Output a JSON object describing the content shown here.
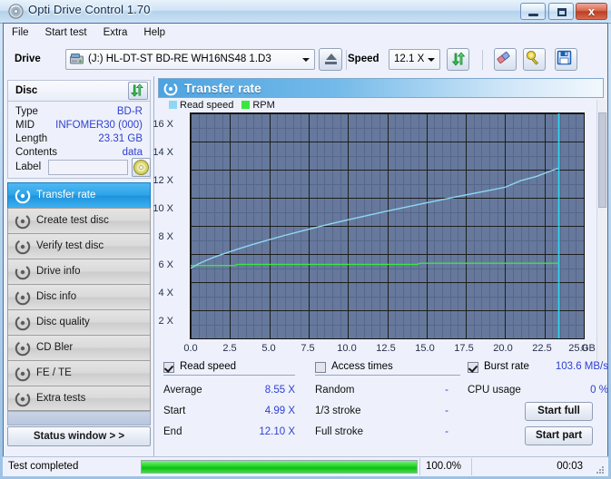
{
  "window": {
    "title": "Opti Drive Control 1.70",
    "icon": "disc-icon",
    "minimize_label": "",
    "maximize_label": "",
    "close_label": "x"
  },
  "menu": {
    "items": [
      "File",
      "Start test",
      "Extra",
      "Help"
    ]
  },
  "toolbar": {
    "drive_label": "Drive",
    "drive_value": "(J:)  HL-DT-ST BD-RE  WH16NS48 1.D3",
    "drive_icon": "drive-icon",
    "eject_label": "eject-icon",
    "speed_label": "Speed",
    "speed_value": "12.1 X",
    "refresh_icon": "refresh-arrows-icon",
    "eraser_icon": "eraser-icon",
    "bulb_icon": "bulb-icon",
    "save_icon": "floppy-save-icon"
  },
  "disc": {
    "header": "Disc",
    "refresh_icon": "refresh-arrows-icon",
    "fields": [
      {
        "key": "Type",
        "value": "BD-R"
      },
      {
        "key": "MID",
        "value": "INFOMER30 (000)"
      },
      {
        "key": "Length",
        "value": "23.31 GB"
      },
      {
        "key": "Contents",
        "value": "data"
      }
    ],
    "label_key": "Label",
    "label_value": "",
    "label_placeholder": "",
    "label_button_icon": "cd-disc-icon"
  },
  "nav": {
    "items": [
      {
        "label": "Transfer rate",
        "icon": "disc-spin-icon",
        "active": true
      },
      {
        "label": "Create test disc",
        "icon": "disc-write-icon",
        "active": false
      },
      {
        "label": "Verify test disc",
        "icon": "disc-check-icon",
        "active": false
      },
      {
        "label": "Drive info",
        "icon": "drive-info-icon",
        "active": false
      },
      {
        "label": "Disc info",
        "icon": "disc-info-icon",
        "active": false
      },
      {
        "label": "Disc quality",
        "icon": "disc-quality-icon",
        "active": false
      },
      {
        "label": "CD Bler",
        "icon": "disc-bler-icon",
        "active": false
      },
      {
        "label": "FE / TE",
        "icon": "disc-fete-icon",
        "active": false
      },
      {
        "label": "Extra tests",
        "icon": "disc-extra-icon",
        "active": false
      }
    ],
    "status_window": "Status window > >"
  },
  "panel": {
    "title": "Transfer rate",
    "icon": "disc-spin-icon"
  },
  "stats": {
    "read_speed": {
      "checkbox_label": "Read speed",
      "checked": true,
      "rows": [
        {
          "key": "Average",
          "value": "8.55 X"
        },
        {
          "key": "Start",
          "value": "4.99 X"
        },
        {
          "key": "End",
          "value": "12.10 X"
        }
      ]
    },
    "access_times": {
      "checkbox_label": "Access times",
      "checked": false,
      "rows": [
        {
          "key": "Random",
          "value": "-"
        },
        {
          "key": "1/3 stroke",
          "value": "-"
        },
        {
          "key": "Full stroke",
          "value": "-"
        }
      ]
    },
    "burst_rate": {
      "checkbox_label": "Burst rate",
      "checked": true,
      "value": "103.6 MB/s",
      "cpu_key": "CPU usage",
      "cpu_value": "0 %"
    },
    "buttons": {
      "start_full": "Start full",
      "start_part": "Start part"
    }
  },
  "statusbar": {
    "text": "Test completed",
    "percent_label": "100.0%",
    "percent": 100,
    "time": "00:03"
  },
  "colors": {
    "read_speed": "#8fd6f5",
    "rpm": "#39e83d",
    "marker": "#2ad6f2",
    "plot_bg": "#66799c",
    "value_text": "#2e3fd0",
    "accent": "#2ea4e8"
  },
  "chart_data": {
    "type": "line",
    "title": "Transfer rate",
    "xlabel": "GB",
    "ylabel": "X",
    "xlim": [
      0.0,
      25.0
    ],
    "ylim": [
      0,
      16
    ],
    "grid": true,
    "legend_position": "top-left",
    "xticks": [
      "0.0",
      "2.5",
      "5.0",
      "7.5",
      "10.0",
      "12.5",
      "15.0",
      "17.5",
      "20.0",
      "22.5",
      "25.0"
    ],
    "yticks": [
      "2 X",
      "4 X",
      "6 X",
      "8 X",
      "10 X",
      "12 X",
      "14 X",
      "16 X"
    ],
    "xunit": "GB",
    "legend": [
      {
        "name": "Read speed",
        "color": "#8fd6f5"
      },
      {
        "name": "RPM",
        "color": "#39e83d"
      }
    ],
    "markers": [
      {
        "name": "end-of-data-marker",
        "x": 23.4,
        "color": "#2ad6f2"
      }
    ],
    "series": [
      {
        "name": "Read speed",
        "color": "#8fd6f5",
        "x": [
          0.0,
          0.5,
          1.0,
          1.5,
          2.0,
          3.0,
          4.0,
          5.0,
          6.0,
          7.0,
          8.0,
          9.0,
          10.0,
          11.0,
          12.0,
          13.0,
          14.0,
          15.0,
          16.0,
          17.0,
          18.0,
          19.0,
          20.0,
          21.0,
          22.0,
          23.0,
          23.4
        ],
        "y": [
          4.99,
          5.3,
          5.55,
          5.78,
          5.98,
          6.35,
          6.7,
          7.02,
          7.33,
          7.62,
          7.9,
          8.17,
          8.43,
          8.68,
          8.93,
          9.17,
          9.41,
          9.64,
          9.87,
          10.09,
          10.31,
          10.53,
          10.75,
          11.22,
          11.52,
          11.95,
          12.1
        ]
      },
      {
        "name": "RPM",
        "color": "#39e83d",
        "x": [
          0.0,
          0.4,
          2.8,
          3.0,
          14.4,
          14.6,
          23.4
        ],
        "y": [
          5.18,
          5.18,
          5.18,
          5.26,
          5.26,
          5.34,
          5.34
        ]
      }
    ],
    "summary": {
      "average": "8.55 X",
      "start": "4.99 X",
      "end": "12.10 X",
      "burst_rate": "103.6 MB/s",
      "cpu_usage": "0 %"
    }
  }
}
